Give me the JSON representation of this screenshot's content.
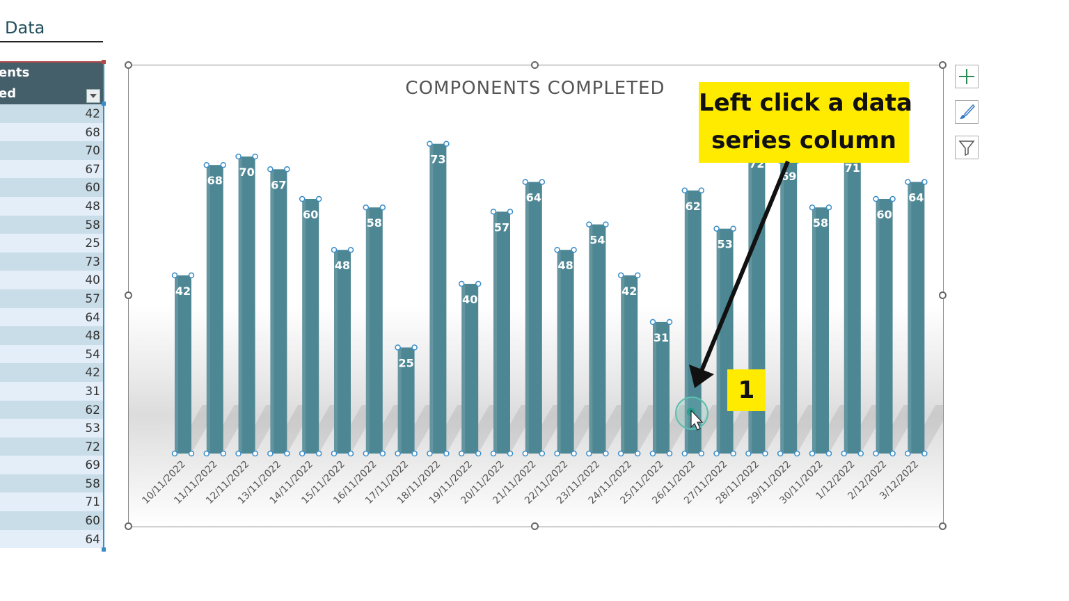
{
  "sheet": {
    "title": "t Data",
    "table": {
      "header_line1": "ents",
      "header_line2": "ed",
      "values": [
        42,
        68,
        70,
        67,
        60,
        48,
        58,
        25,
        73,
        40,
        57,
        64,
        48,
        54,
        42,
        31,
        62,
        53,
        72,
        69,
        58,
        71,
        60,
        64
      ]
    }
  },
  "chart_data": {
    "type": "bar",
    "title": "COMPONENTS COMPLETED",
    "categories": [
      "10/11/2022",
      "11/11/2022",
      "12/11/2022",
      "13/11/2022",
      "14/11/2022",
      "15/11/2022",
      "16/11/2022",
      "17/11/2022",
      "18/11/2022",
      "19/11/2022",
      "20/11/2022",
      "21/11/2022",
      "22/11/2022",
      "23/11/2022",
      "24/11/2022",
      "25/11/2022",
      "26/11/2022",
      "27/11/2022",
      "28/11/2022",
      "29/11/2022",
      "30/11/2022",
      "1/12/2022",
      "2/12/2022",
      "3/12/2022"
    ],
    "values": [
      42,
      68,
      70,
      67,
      60,
      48,
      58,
      25,
      73,
      40,
      57,
      64,
      48,
      54,
      42,
      31,
      62,
      53,
      72,
      69,
      58,
      71,
      60,
      64
    ],
    "selected_series": true,
    "bar_color": "#4e8794",
    "grid": false
  },
  "chart_tools": {
    "elements_icon": "plus-icon",
    "styles_icon": "brush-icon",
    "filter_icon": "funnel-icon"
  },
  "annotation": {
    "line1": "Left click a data",
    "line2": "series column",
    "step": "1",
    "color": "#ffeb00"
  }
}
